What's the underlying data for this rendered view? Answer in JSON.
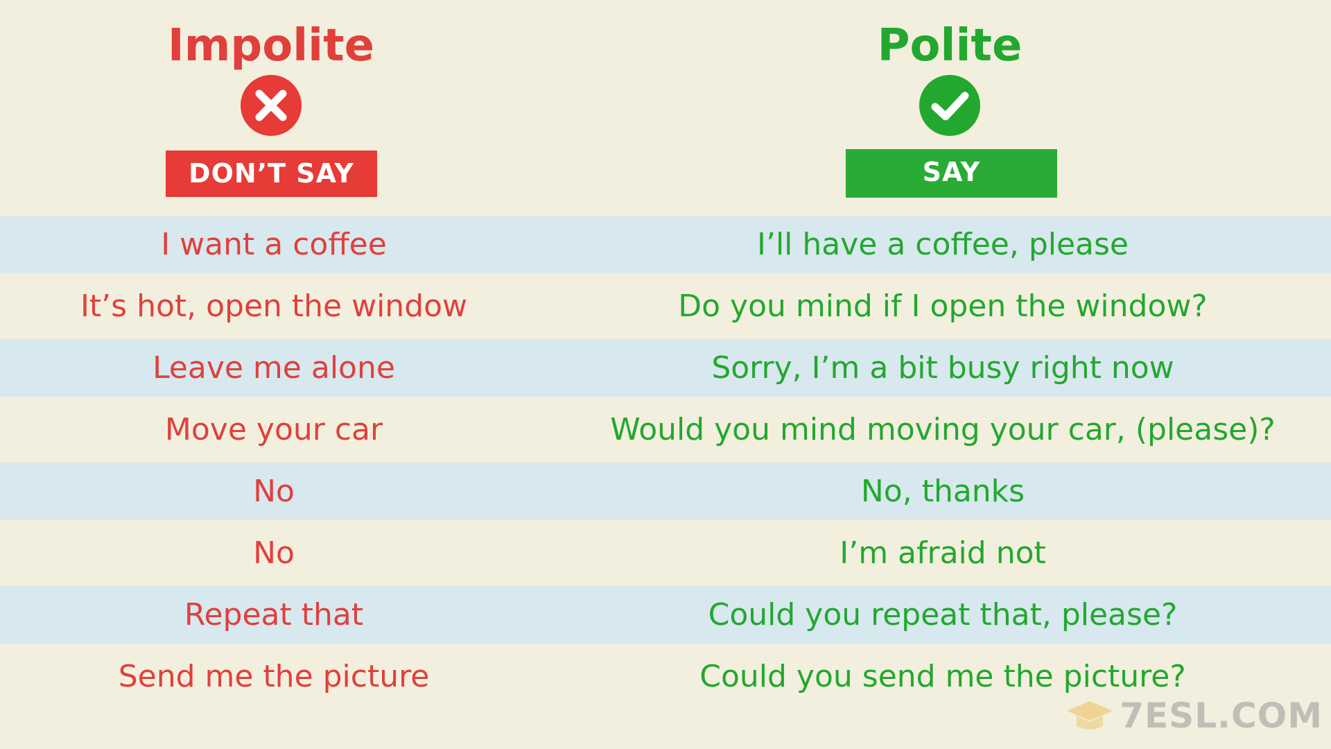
{
  "impolite": {
    "title": "Impolite",
    "label": "DON’T SAY",
    "icon": "x-circle-icon",
    "color": "#e0403c"
  },
  "polite": {
    "title": "Polite",
    "label": "SAY",
    "icon": "check-circle-icon",
    "color": "#22a82e"
  },
  "rows": [
    {
      "impolite": "I want a coffee",
      "polite": "I’ll have a coffee, please"
    },
    {
      "impolite": "It’s hot, open the window",
      "polite": "Do you mind if I open the window?"
    },
    {
      "impolite": "Leave me alone",
      "polite": "Sorry, I’m a bit busy right now"
    },
    {
      "impolite": "Move your car",
      "polite": "Would you mind moving your car, (please)?"
    },
    {
      "impolite": "No",
      "polite": "No, thanks"
    },
    {
      "impolite": "No",
      "polite": "I’m afraid not"
    },
    {
      "impolite": "Repeat that",
      "polite": "Could you repeat that, please?"
    },
    {
      "impolite": "Send me the picture",
      "polite": "Could you send me the picture?"
    }
  ],
  "logo": {
    "text": "7ESL.COM"
  },
  "colors": {
    "background": "#f3efde",
    "band": "#d8e8ef"
  }
}
